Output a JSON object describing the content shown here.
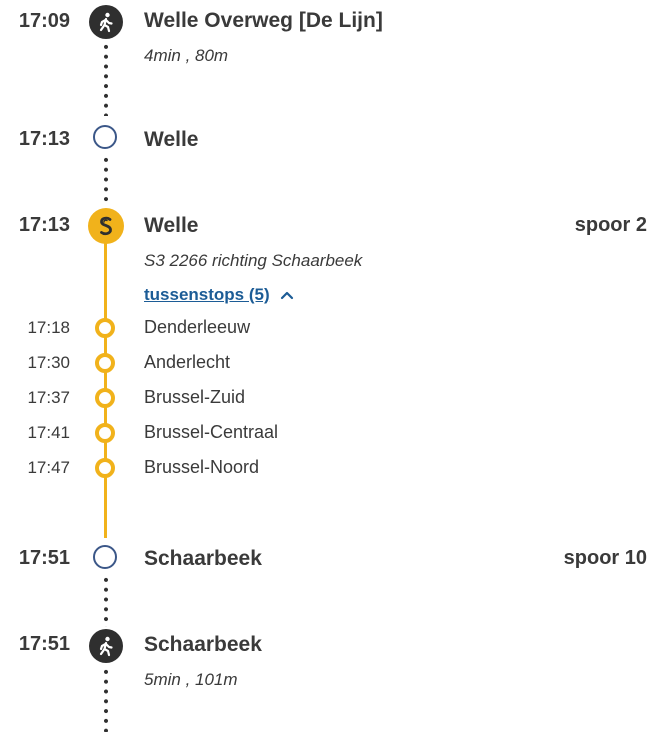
{
  "colors": {
    "line_yellow": "#f1b21b",
    "ring_blue": "#3b5788",
    "walk_dark": "#2f2f2f",
    "link_blue": "#1c5c96"
  },
  "legs": {
    "walk1": {
      "time": "17:09",
      "stop": "Welle Overweg [De Lijn]",
      "detail": "4min , 80m",
      "icon": "walking-person-icon"
    },
    "arrive1": {
      "time": "17:13",
      "stop": "Welle"
    },
    "train": {
      "time": "17:13",
      "stop": "Welle",
      "track": "spoor 2",
      "detail": "S3 2266 richting Schaarbeek",
      "toggle_label": "tussenstops (5)",
      "icon": "train-s-icon",
      "intermediate": [
        {
          "time": "17:18",
          "stop": "Denderleeuw"
        },
        {
          "time": "17:30",
          "stop": "Anderlecht"
        },
        {
          "time": "17:37",
          "stop": "Brussel-Zuid"
        },
        {
          "time": "17:41",
          "stop": "Brussel-Centraal"
        },
        {
          "time": "17:47",
          "stop": "Brussel-Noord"
        }
      ]
    },
    "arrive2": {
      "time": "17:51",
      "stop": "Schaarbeek",
      "track": "spoor 10"
    },
    "walk2": {
      "time": "17:51",
      "stop": "Schaarbeek",
      "detail": "5min , 101m",
      "icon": "walking-person-icon"
    }
  }
}
